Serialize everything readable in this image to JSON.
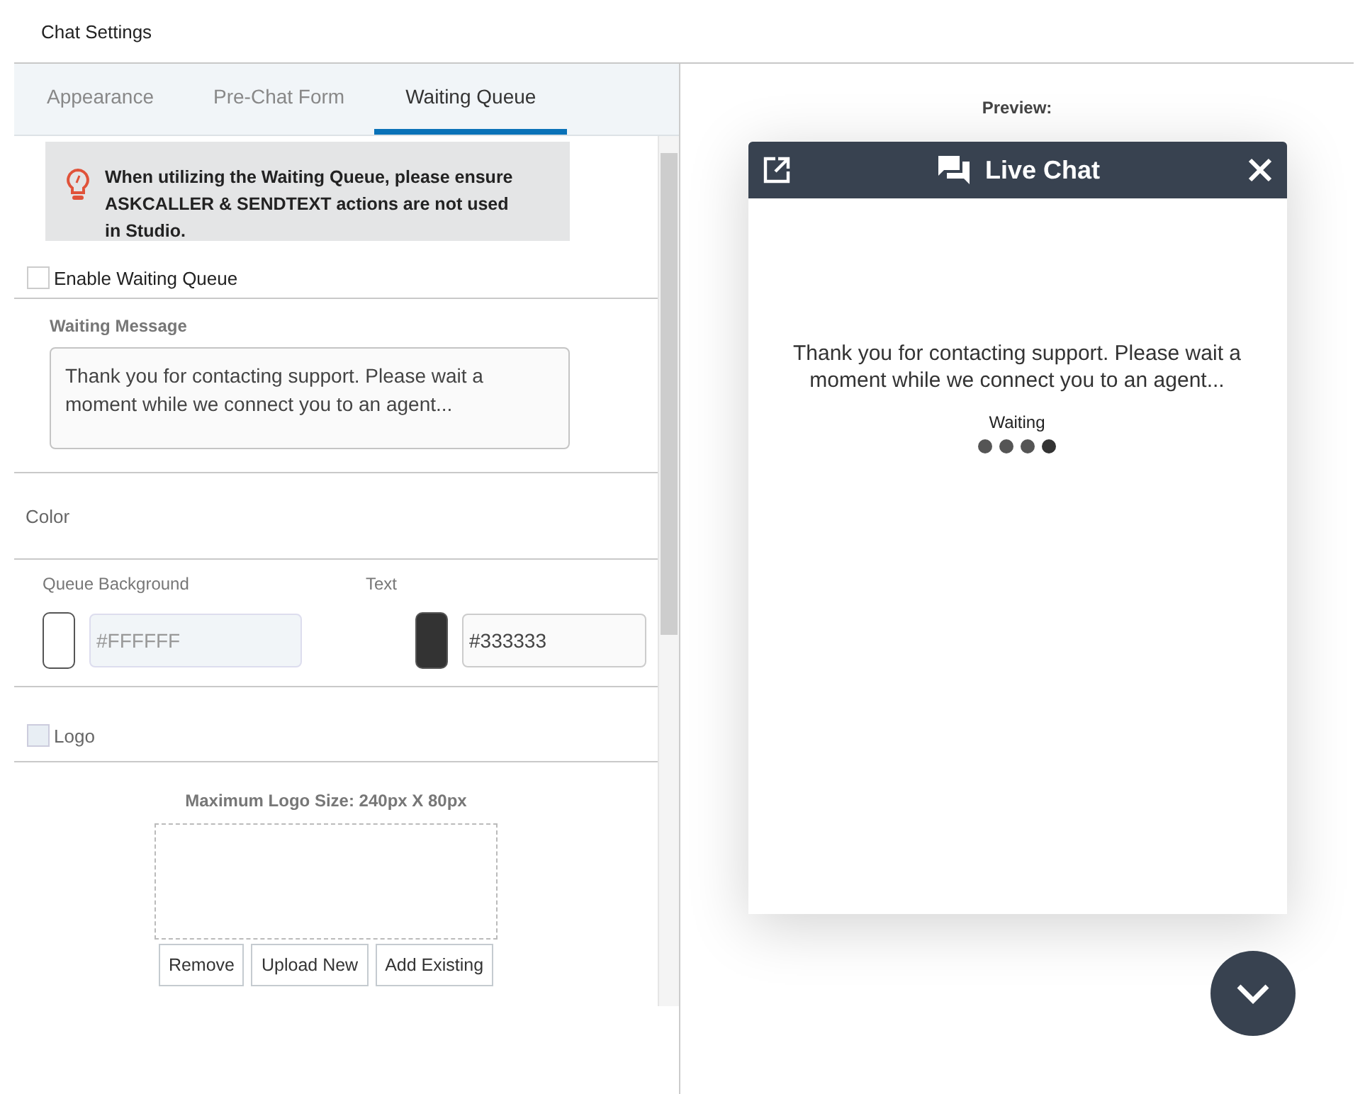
{
  "header": {
    "title": "Chat Settings"
  },
  "tabs": [
    {
      "label": "Appearance",
      "selected": false
    },
    {
      "label": "Pre-Chat Form",
      "selected": false
    },
    {
      "label": "Waiting Queue",
      "selected": true
    }
  ],
  "notice": "When utilizing the Waiting Queue, please ensure ASKCALLER & SENDTEXT actions are not used in Studio.",
  "enable_queue": {
    "label": "Enable Waiting Queue",
    "checked": false
  },
  "waiting_message": {
    "label": "Waiting Message",
    "value": "Thank you for contacting support. Please wait a moment while we connect you to an agent..."
  },
  "color": {
    "title": "Color",
    "fields": [
      {
        "label": "Queue Background",
        "value": "#FFFFFF",
        "disabled": true
      },
      {
        "label": "Text",
        "value": "#333333",
        "disabled": false
      }
    ]
  },
  "logo": {
    "label": "Logo",
    "checked": false,
    "disabled": true,
    "size_hint": "Maximum Logo Size: 240px X 80px",
    "buttons": [
      "Remove",
      "Upload New",
      "Add Existing"
    ]
  },
  "preview": {
    "label": "Preview:",
    "title": "Live Chat",
    "message": "Thank you for contacting support. Please wait a moment while we connect you to an agent...",
    "status": "Waiting"
  }
}
